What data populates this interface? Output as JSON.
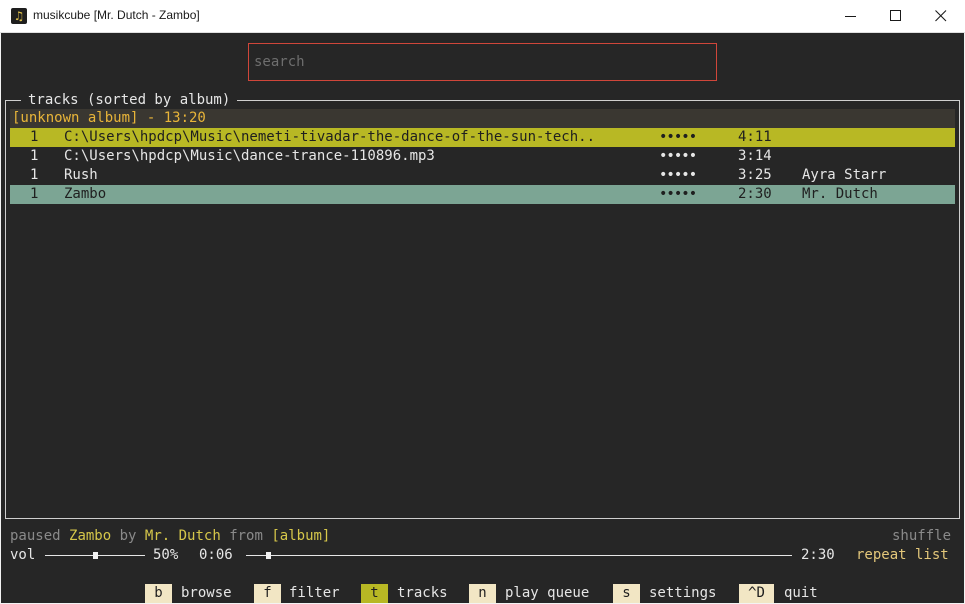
{
  "window": {
    "title": "musikcube [Mr. Dutch - Zambo]",
    "icon": "music-note-icon"
  },
  "search": {
    "placeholder": "search",
    "value": ""
  },
  "tracks_panel": {
    "title": "tracks (sorted by album)",
    "album_header": "[unknown album] - 13:20",
    "rows": [
      {
        "num": "1",
        "title": "C:\\Users\\hpdcp\\Music\\nemeti-tivadar-the-dance-of-the-sun-tech..",
        "rating": "•••••",
        "duration": "4:11",
        "artist": "",
        "state": "playing"
      },
      {
        "num": "1",
        "title": "C:\\Users\\hpdcp\\Music\\dance-trance-110896.mp3",
        "rating": "•••••",
        "duration": "3:14",
        "artist": "",
        "state": "normal"
      },
      {
        "num": "1",
        "title": "Rush",
        "rating": "•••••",
        "duration": "3:25",
        "artist": "Ayra Starr",
        "state": "normal"
      },
      {
        "num": "1",
        "title": "Zambo",
        "rating": "•••••",
        "duration": "2:30",
        "artist": "Mr. Dutch",
        "state": "selected"
      }
    ]
  },
  "status": {
    "state": "paused",
    "track": "Zambo",
    "by": "by",
    "artist": "Mr. Dutch",
    "from": "from",
    "album": "[album]",
    "shuffle": "shuffle"
  },
  "transport": {
    "vol_label": "vol",
    "volume": "50%",
    "volume_fraction": 0.5,
    "elapsed": "0:06",
    "progress_fraction": 0.04,
    "total": "2:30",
    "repeat": "repeat list"
  },
  "keybar": [
    {
      "key": "b",
      "label": "browse",
      "active": false
    },
    {
      "key": "f",
      "label": "filter",
      "active": false
    },
    {
      "key": "t",
      "label": "tracks",
      "active": true
    },
    {
      "key": "n",
      "label": "play queue",
      "active": false
    },
    {
      "key": "s",
      "label": "settings",
      "active": false
    },
    {
      "key": "^D",
      "label": "quit",
      "active": false
    }
  ],
  "colors": {
    "background": "#262626",
    "playing_row": "#b8b824",
    "selected_row": "#7ca594",
    "album_text": "#e9b539",
    "search_border": "#d0463a"
  }
}
